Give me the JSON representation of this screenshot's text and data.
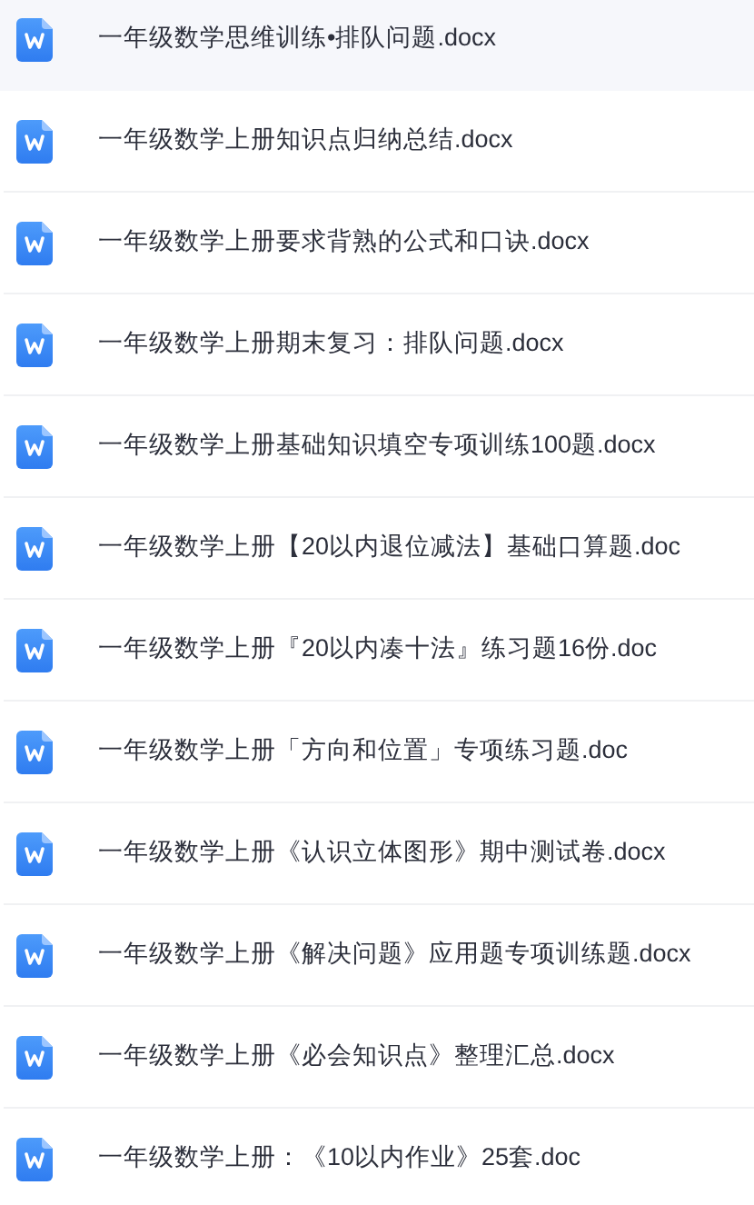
{
  "files": [
    {
      "name": "一年级数学思维训练•排队问题.docx",
      "selected": true
    },
    {
      "name": "一年级数学上册知识点归纳总结.docx",
      "selected": false
    },
    {
      "name": "一年级数学上册要求背熟的公式和口诀.docx",
      "selected": false
    },
    {
      "name": "一年级数学上册期末复习：排队问题.docx",
      "selected": false
    },
    {
      "name": "一年级数学上册基础知识填空专项训练100题.docx",
      "selected": false
    },
    {
      "name": "一年级数学上册【20以内退位减法】基础口算题.doc",
      "selected": false
    },
    {
      "name": "一年级数学上册『20以内凑十法』练习题16份.doc",
      "selected": false
    },
    {
      "name": "一年级数学上册「方向和位置」专项练习题.doc",
      "selected": false
    },
    {
      "name": "一年级数学上册《认识立体图形》期中测试卷.docx",
      "selected": false
    },
    {
      "name": "一年级数学上册《解决问题》应用题专项训练题.docx",
      "selected": false
    },
    {
      "name": "一年级数学上册《必会知识点》整理汇总.docx",
      "selected": false
    },
    {
      "name": "一年级数学上册：《10以内作业》25套.doc",
      "selected": false
    }
  ]
}
